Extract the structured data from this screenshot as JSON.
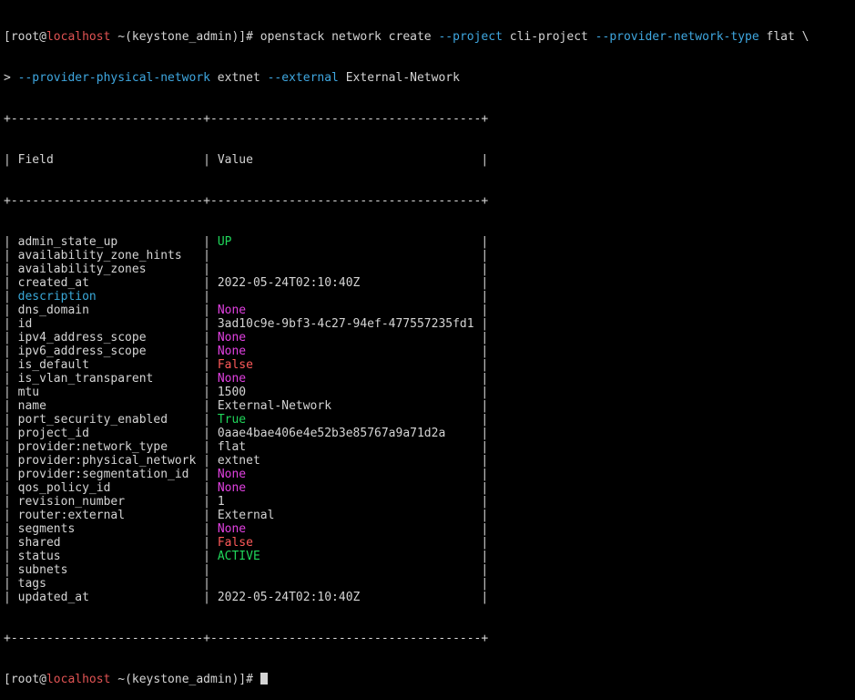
{
  "colors": {
    "background": "#000000",
    "text": "#d4d4d4",
    "host": "#e05353",
    "option": "#3fa7e0",
    "green": "#20d65a",
    "magenta": "#e040e0",
    "red": "#ff5a5a",
    "cyan": "#3aa8d8"
  },
  "prompt": {
    "open_bracket": "[",
    "user": "root@",
    "host": "localhost",
    "path": " ~(keystone_admin)]# "
  },
  "command": {
    "line1": [
      {
        "text": "openstack network create ",
        "color": "default"
      },
      {
        "text": "--project",
        "color": "option"
      },
      {
        "text": " cli-project ",
        "color": "default"
      },
      {
        "text": "--provider-network-type",
        "color": "option"
      },
      {
        "text": " flat \\",
        "color": "default"
      }
    ],
    "line2": [
      {
        "text": "> ",
        "color": "default"
      },
      {
        "text": "--provider-physical-network",
        "color": "option"
      },
      {
        "text": " extnet ",
        "color": "default"
      },
      {
        "text": "--external",
        "color": "option"
      },
      {
        "text": " External-Network",
        "color": "default"
      }
    ]
  },
  "table": {
    "separator": "+---------------------------+--------------------------------------+",
    "header_field": "Field",
    "header_value": "Value",
    "rows": [
      {
        "field": "admin_state_up",
        "value": "UP",
        "field_color": "default",
        "value_color": "green"
      },
      {
        "field": "availability_zone_hints",
        "value": "",
        "field_color": "default",
        "value_color": "default"
      },
      {
        "field": "availability_zones",
        "value": "",
        "field_color": "default",
        "value_color": "default"
      },
      {
        "field": "created_at",
        "value": "2022-05-24T02:10:40Z",
        "field_color": "default",
        "value_color": "default"
      },
      {
        "field": "description",
        "value": "",
        "field_color": "cyan",
        "value_color": "default"
      },
      {
        "field": "dns_domain",
        "value": "None",
        "field_color": "default",
        "value_color": "magenta"
      },
      {
        "field": "id",
        "value": "3ad10c9e-9bf3-4c27-94ef-477557235fd1",
        "field_color": "default",
        "value_color": "default"
      },
      {
        "field": "ipv4_address_scope",
        "value": "None",
        "field_color": "default",
        "value_color": "magenta"
      },
      {
        "field": "ipv6_address_scope",
        "value": "None",
        "field_color": "default",
        "value_color": "magenta"
      },
      {
        "field": "is_default",
        "value": "False",
        "field_color": "default",
        "value_color": "red"
      },
      {
        "field": "is_vlan_transparent",
        "value": "None",
        "field_color": "default",
        "value_color": "magenta"
      },
      {
        "field": "mtu",
        "value": "1500",
        "field_color": "default",
        "value_color": "default"
      },
      {
        "field": "name",
        "value": "External-Network",
        "field_color": "default",
        "value_color": "default"
      },
      {
        "field": "port_security_enabled",
        "value": "True",
        "field_color": "default",
        "value_color": "green"
      },
      {
        "field": "project_id",
        "value": "0aae4bae406e4e52b3e85767a9a71d2a",
        "field_color": "default",
        "value_color": "default"
      },
      {
        "field": "provider:network_type",
        "value": "flat",
        "field_color": "default",
        "value_color": "default"
      },
      {
        "field": "provider:physical_network",
        "value": "extnet",
        "field_color": "default",
        "value_color": "default"
      },
      {
        "field": "provider:segmentation_id",
        "value": "None",
        "field_color": "default",
        "value_color": "magenta"
      },
      {
        "field": "qos_policy_id",
        "value": "None",
        "field_color": "default",
        "value_color": "magenta"
      },
      {
        "field": "revision_number",
        "value": "1",
        "field_color": "default",
        "value_color": "default"
      },
      {
        "field": "router:external",
        "value": "External",
        "field_color": "default",
        "value_color": "default"
      },
      {
        "field": "segments",
        "value": "None",
        "field_color": "default",
        "value_color": "magenta"
      },
      {
        "field": "shared",
        "value": "False",
        "field_color": "default",
        "value_color": "red"
      },
      {
        "field": "status",
        "value": "ACTIVE",
        "field_color": "default",
        "value_color": "green"
      },
      {
        "field": "subnets",
        "value": "",
        "field_color": "default",
        "value_color": "default"
      },
      {
        "field": "tags",
        "value": "",
        "field_color": "default",
        "value_color": "default"
      },
      {
        "field": "updated_at",
        "value": "2022-05-24T02:10:40Z",
        "field_color": "default",
        "value_color": "default"
      }
    ]
  }
}
